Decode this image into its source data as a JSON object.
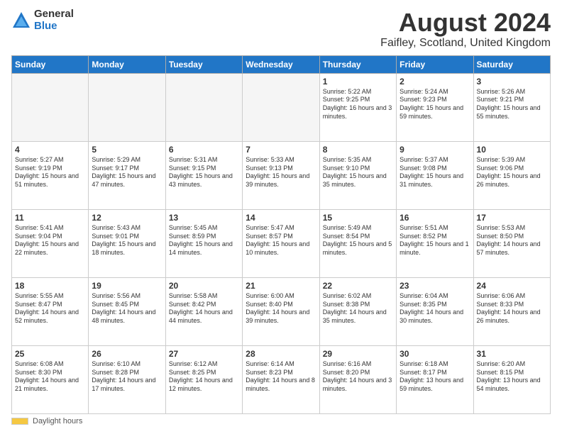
{
  "logo": {
    "general": "General",
    "blue": "Blue"
  },
  "title": "August 2024",
  "subtitle": "Faifley, Scotland, United Kingdom",
  "days_of_week": [
    "Sunday",
    "Monday",
    "Tuesday",
    "Wednesday",
    "Thursday",
    "Friday",
    "Saturday"
  ],
  "footer": {
    "legend_label": "Daylight hours"
  },
  "weeks": [
    [
      {
        "day": "",
        "sunrise": "",
        "sunset": "",
        "daylight": "",
        "empty": true
      },
      {
        "day": "",
        "sunrise": "",
        "sunset": "",
        "daylight": "",
        "empty": true
      },
      {
        "day": "",
        "sunrise": "",
        "sunset": "",
        "daylight": "",
        "empty": true
      },
      {
        "day": "",
        "sunrise": "",
        "sunset": "",
        "daylight": "",
        "empty": true
      },
      {
        "day": "1",
        "sunrise": "Sunrise: 5:22 AM",
        "sunset": "Sunset: 9:25 PM",
        "daylight": "Daylight: 16 hours and 3 minutes.",
        "empty": false
      },
      {
        "day": "2",
        "sunrise": "Sunrise: 5:24 AM",
        "sunset": "Sunset: 9:23 PM",
        "daylight": "Daylight: 15 hours and 59 minutes.",
        "empty": false
      },
      {
        "day": "3",
        "sunrise": "Sunrise: 5:26 AM",
        "sunset": "Sunset: 9:21 PM",
        "daylight": "Daylight: 15 hours and 55 minutes.",
        "empty": false
      }
    ],
    [
      {
        "day": "4",
        "sunrise": "Sunrise: 5:27 AM",
        "sunset": "Sunset: 9:19 PM",
        "daylight": "Daylight: 15 hours and 51 minutes.",
        "empty": false
      },
      {
        "day": "5",
        "sunrise": "Sunrise: 5:29 AM",
        "sunset": "Sunset: 9:17 PM",
        "daylight": "Daylight: 15 hours and 47 minutes.",
        "empty": false
      },
      {
        "day": "6",
        "sunrise": "Sunrise: 5:31 AM",
        "sunset": "Sunset: 9:15 PM",
        "daylight": "Daylight: 15 hours and 43 minutes.",
        "empty": false
      },
      {
        "day": "7",
        "sunrise": "Sunrise: 5:33 AM",
        "sunset": "Sunset: 9:13 PM",
        "daylight": "Daylight: 15 hours and 39 minutes.",
        "empty": false
      },
      {
        "day": "8",
        "sunrise": "Sunrise: 5:35 AM",
        "sunset": "Sunset: 9:10 PM",
        "daylight": "Daylight: 15 hours and 35 minutes.",
        "empty": false
      },
      {
        "day": "9",
        "sunrise": "Sunrise: 5:37 AM",
        "sunset": "Sunset: 9:08 PM",
        "daylight": "Daylight: 15 hours and 31 minutes.",
        "empty": false
      },
      {
        "day": "10",
        "sunrise": "Sunrise: 5:39 AM",
        "sunset": "Sunset: 9:06 PM",
        "daylight": "Daylight: 15 hours and 26 minutes.",
        "empty": false
      }
    ],
    [
      {
        "day": "11",
        "sunrise": "Sunrise: 5:41 AM",
        "sunset": "Sunset: 9:04 PM",
        "daylight": "Daylight: 15 hours and 22 minutes.",
        "empty": false
      },
      {
        "day": "12",
        "sunrise": "Sunrise: 5:43 AM",
        "sunset": "Sunset: 9:01 PM",
        "daylight": "Daylight: 15 hours and 18 minutes.",
        "empty": false
      },
      {
        "day": "13",
        "sunrise": "Sunrise: 5:45 AM",
        "sunset": "Sunset: 8:59 PM",
        "daylight": "Daylight: 15 hours and 14 minutes.",
        "empty": false
      },
      {
        "day": "14",
        "sunrise": "Sunrise: 5:47 AM",
        "sunset": "Sunset: 8:57 PM",
        "daylight": "Daylight: 15 hours and 10 minutes.",
        "empty": false
      },
      {
        "day": "15",
        "sunrise": "Sunrise: 5:49 AM",
        "sunset": "Sunset: 8:54 PM",
        "daylight": "Daylight: 15 hours and 5 minutes.",
        "empty": false
      },
      {
        "day": "16",
        "sunrise": "Sunrise: 5:51 AM",
        "sunset": "Sunset: 8:52 PM",
        "daylight": "Daylight: 15 hours and 1 minute.",
        "empty": false
      },
      {
        "day": "17",
        "sunrise": "Sunrise: 5:53 AM",
        "sunset": "Sunset: 8:50 PM",
        "daylight": "Daylight: 14 hours and 57 minutes.",
        "empty": false
      }
    ],
    [
      {
        "day": "18",
        "sunrise": "Sunrise: 5:55 AM",
        "sunset": "Sunset: 8:47 PM",
        "daylight": "Daylight: 14 hours and 52 minutes.",
        "empty": false
      },
      {
        "day": "19",
        "sunrise": "Sunrise: 5:56 AM",
        "sunset": "Sunset: 8:45 PM",
        "daylight": "Daylight: 14 hours and 48 minutes.",
        "empty": false
      },
      {
        "day": "20",
        "sunrise": "Sunrise: 5:58 AM",
        "sunset": "Sunset: 8:42 PM",
        "daylight": "Daylight: 14 hours and 44 minutes.",
        "empty": false
      },
      {
        "day": "21",
        "sunrise": "Sunrise: 6:00 AM",
        "sunset": "Sunset: 8:40 PM",
        "daylight": "Daylight: 14 hours and 39 minutes.",
        "empty": false
      },
      {
        "day": "22",
        "sunrise": "Sunrise: 6:02 AM",
        "sunset": "Sunset: 8:38 PM",
        "daylight": "Daylight: 14 hours and 35 minutes.",
        "empty": false
      },
      {
        "day": "23",
        "sunrise": "Sunrise: 6:04 AM",
        "sunset": "Sunset: 8:35 PM",
        "daylight": "Daylight: 14 hours and 30 minutes.",
        "empty": false
      },
      {
        "day": "24",
        "sunrise": "Sunrise: 6:06 AM",
        "sunset": "Sunset: 8:33 PM",
        "daylight": "Daylight: 14 hours and 26 minutes.",
        "empty": false
      }
    ],
    [
      {
        "day": "25",
        "sunrise": "Sunrise: 6:08 AM",
        "sunset": "Sunset: 8:30 PM",
        "daylight": "Daylight: 14 hours and 21 minutes.",
        "empty": false
      },
      {
        "day": "26",
        "sunrise": "Sunrise: 6:10 AM",
        "sunset": "Sunset: 8:28 PM",
        "daylight": "Daylight: 14 hours and 17 minutes.",
        "empty": false
      },
      {
        "day": "27",
        "sunrise": "Sunrise: 6:12 AM",
        "sunset": "Sunset: 8:25 PM",
        "daylight": "Daylight: 14 hours and 12 minutes.",
        "empty": false
      },
      {
        "day": "28",
        "sunrise": "Sunrise: 6:14 AM",
        "sunset": "Sunset: 8:23 PM",
        "daylight": "Daylight: 14 hours and 8 minutes.",
        "empty": false
      },
      {
        "day": "29",
        "sunrise": "Sunrise: 6:16 AM",
        "sunset": "Sunset: 8:20 PM",
        "daylight": "Daylight: 14 hours and 3 minutes.",
        "empty": false
      },
      {
        "day": "30",
        "sunrise": "Sunrise: 6:18 AM",
        "sunset": "Sunset: 8:17 PM",
        "daylight": "Daylight: 13 hours and 59 minutes.",
        "empty": false
      },
      {
        "day": "31",
        "sunrise": "Sunrise: 6:20 AM",
        "sunset": "Sunset: 8:15 PM",
        "daylight": "Daylight: 13 hours and 54 minutes.",
        "empty": false
      }
    ]
  ]
}
